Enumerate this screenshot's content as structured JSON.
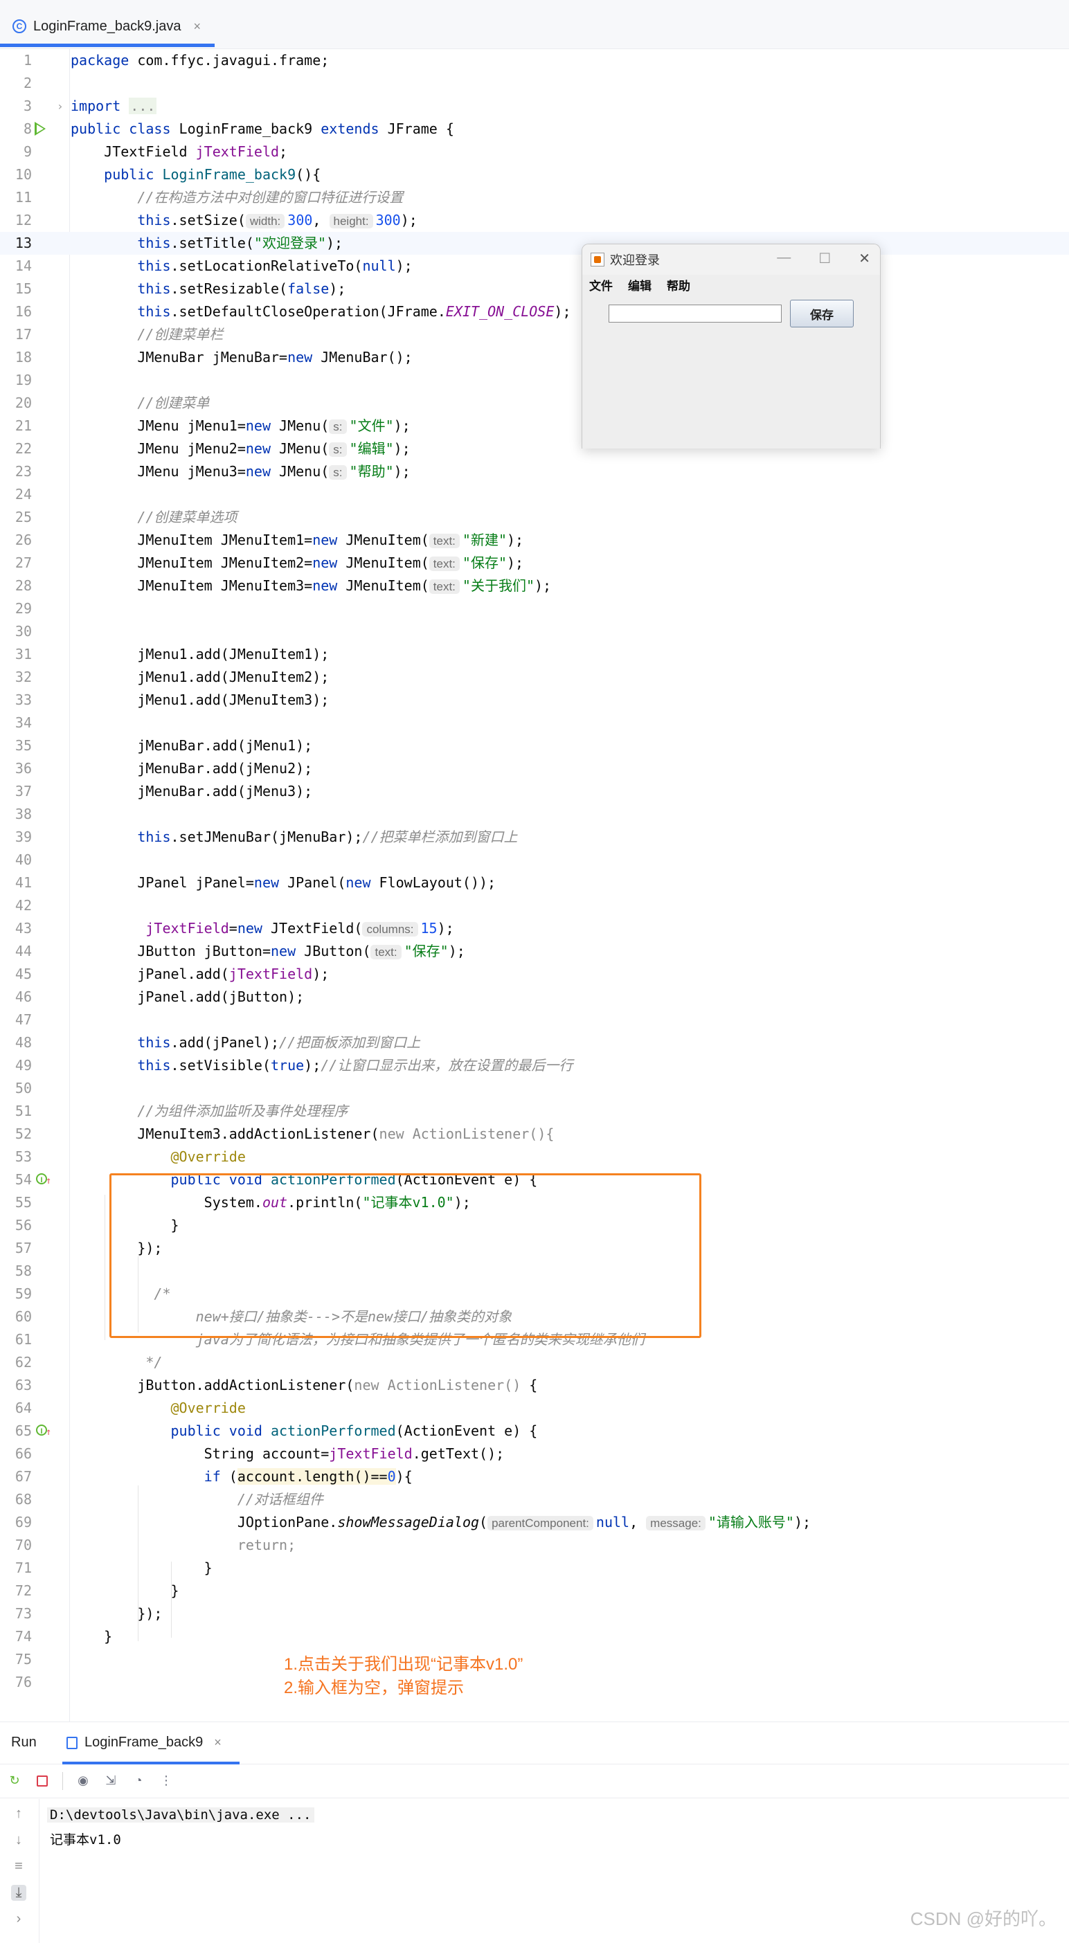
{
  "tab": {
    "filename": "LoginFrame_back9.java",
    "close": "×"
  },
  "code": {
    "l1": {
      "num": "1",
      "kw": "package",
      "rest": " com.ffyc.javagui.frame;"
    },
    "l2": {
      "num": "2"
    },
    "l3": {
      "num": "3",
      "kw": "import",
      "folded": "..."
    },
    "l4": {
      "num": "8",
      "kw1": "public",
      "kw2": "class",
      "name": " LoginFrame_back9 ",
      "kw3": "extends",
      "rest": " JFrame {"
    },
    "l5": {
      "num": "9",
      "type": "JTextField ",
      "field": "jTextField",
      "rest": ";"
    },
    "l6": {
      "num": "10",
      "kw": "public",
      "ctor": "LoginFrame_back9",
      "rest": "(){"
    },
    "l7": {
      "num": "11",
      "comment": "//在构造方法中对创建的窗口特征进行设置"
    },
    "l8": {
      "num": "12",
      "this": "this",
      "call": ".setSize(",
      "h1": "width:",
      "v1": "300",
      "sep": ", ",
      "h2": "height:",
      "v2": "300",
      "end": ");"
    },
    "l9": {
      "num": "13",
      "this": "this",
      "call": ".setTitle(",
      "str": "\"欢迎登录\"",
      "end": ");"
    },
    "l10": {
      "num": "14",
      "this": "this",
      "call": ".setLocationRelativeTo(",
      "kw": "null",
      "end": ");"
    },
    "l11": {
      "num": "15",
      "this": "this",
      "call": ".setResizable(",
      "kw": "false",
      "end": ");"
    },
    "l12": {
      "num": "16",
      "this": "this",
      "call": ".setDefaultCloseOperation(JFrame.",
      "sfield": "EXIT_ON_CLOSE",
      "end": ");"
    },
    "l13": {
      "num": "17",
      "comment": "//创建菜单栏"
    },
    "l14": {
      "num": "18",
      "a": "JMenuBar jMenuBar=",
      "kw": "new",
      "b": " JMenuBar();"
    },
    "l15": {
      "num": "19"
    },
    "l16": {
      "num": "20",
      "comment": "//创建菜单"
    },
    "l17": {
      "num": "21",
      "a": "JMenu jMenu1=",
      "kw": "new",
      "b": " JMenu(",
      "hint": "s:",
      "str": "\"文件\"",
      "end": ");"
    },
    "l18": {
      "num": "22",
      "a": "JMenu jMenu2=",
      "kw": "new",
      "b": " JMenu(",
      "hint": "s:",
      "str": "\"编辑\"",
      "end": ");"
    },
    "l19": {
      "num": "23",
      "a": "JMenu jMenu3=",
      "kw": "new",
      "b": " JMenu(",
      "hint": "s:",
      "str": "\"帮助\"",
      "end": ");"
    },
    "l20": {
      "num": "24"
    },
    "l21": {
      "num": "25",
      "comment": "//创建菜单选项"
    },
    "l22": {
      "num": "26",
      "a": "JMenuItem JMenuItem1=",
      "kw": "new",
      "b": " JMenuItem(",
      "hint": "text:",
      "str": "\"新建\"",
      "end": ");"
    },
    "l23": {
      "num": "27",
      "a": "JMenuItem JMenuItem2=",
      "kw": "new",
      "b": " JMenuItem(",
      "hint": "text:",
      "str": "\"保存\"",
      "end": ");"
    },
    "l24": {
      "num": "28",
      "a": "JMenuItem JMenuItem3=",
      "kw": "new",
      "b": " JMenuItem(",
      "hint": "text:",
      "str": "\"关于我们\"",
      "end": ");"
    },
    "l25": {
      "num": "29"
    },
    "l26": {
      "num": "30"
    },
    "l27": {
      "num": "31",
      "text": "jMenu1.add(JMenuItem1);"
    },
    "l28": {
      "num": "32",
      "text": "jMenu1.add(JMenuItem2);"
    },
    "l29": {
      "num": "33",
      "text": "jMenu1.add(JMenuItem3);"
    },
    "l30": {
      "num": "34"
    },
    "l31": {
      "num": "35",
      "text": "jMenuBar.add(jMenu1);"
    },
    "l32": {
      "num": "36",
      "text": "jMenuBar.add(jMenu2);"
    },
    "l33": {
      "num": "37",
      "text": "jMenuBar.add(jMenu3);"
    },
    "l34": {
      "num": "38"
    },
    "l35": {
      "num": "39",
      "this": "this",
      "call": ".setJMenuBar(jMenuBar);",
      "comment": "//把菜单栏添加到窗口上"
    },
    "l36": {
      "num": "40"
    },
    "l37": {
      "num": "41",
      "a": "JPanel jPanel=",
      "kw1": "new",
      "b": " JPanel(",
      "kw2": "new",
      "c": " FlowLayout());"
    },
    "l38": {
      "num": "42"
    },
    "l39": {
      "num": "43",
      "field": "jTextField",
      "a": "=",
      "kw": "new",
      "b": " JTextField(",
      "hint": "columns:",
      "n": "15",
      "end": ");"
    },
    "l40": {
      "num": "44",
      "a": "JButton jButton=",
      "kw": "new",
      "b": " JButton(",
      "hint": "text:",
      "str": "\"保存\"",
      "end": ");"
    },
    "l41": {
      "num": "45",
      "a": "jPanel.add(",
      "field": "jTextField",
      "end": ");"
    },
    "l42": {
      "num": "46",
      "text": "jPanel.add(jButton);"
    },
    "l43": {
      "num": "47"
    },
    "l44": {
      "num": "48",
      "this": "this",
      "call": ".add(jPanel);",
      "comment": "//把面板添加到窗口上"
    },
    "l45": {
      "num": "49",
      "this": "this",
      "call": ".setVisible(",
      "kw": "true",
      "end": ");",
      "comment": "//让窗口显示出来，放在设置的最后一行"
    },
    "l46": {
      "num": "50"
    },
    "l47": {
      "num": "51",
      "comment": "//为组件添加监听及事件处理程序"
    },
    "l48": {
      "num": "52",
      "a": "JMenuItem3.addActionListener(",
      "kw": "new",
      "anon": " ActionListener(){"
    },
    "l49": {
      "num": "53",
      "ann": "@Override"
    },
    "l50": {
      "num": "54",
      "kw1": "public",
      "kw2": "void",
      "fn": "actionPerformed",
      "rest": "(ActionEvent e) {"
    },
    "l51": {
      "num": "55",
      "a": "System.",
      "sfield": "out",
      "b": ".println(",
      "str": "\"记事本v1.0\"",
      "end": ");"
    },
    "l52": {
      "num": "56",
      "text": "}"
    },
    "l53": {
      "num": "57",
      "text": "});"
    },
    "l54": {
      "num": "58"
    },
    "l55": {
      "num": "59",
      "comment": "/*"
    },
    "l56": {
      "num": "60",
      "comment": "new+接口/抽象类--->不是new接口/抽象类的对象"
    },
    "l57": {
      "num": "61",
      "comment": "java为了简化语法，为接口和抽象类提供了一个匿名的类来实现继承他们"
    },
    "l58": {
      "num": "62",
      "comment": "*/"
    },
    "l59": {
      "num": "63",
      "a": "jButton.addActionListener(",
      "kw": "new",
      "anon": " ActionListener()",
      "b": " {"
    },
    "l60": {
      "num": "64",
      "ann": "@Override"
    },
    "l61": {
      "num": "65",
      "kw1": "public",
      "kw2": "void",
      "fn": "actionPerformed",
      "rest": "(ActionEvent e) {"
    },
    "l62": {
      "num": "66",
      "a": "String account=",
      "field": "jTextField",
      "b": ".getText();"
    },
    "l63": {
      "num": "67",
      "kw": "if",
      "a": " (",
      "cond": "account.length()==",
      "n": "0",
      "b": "){"
    },
    "l64": {
      "num": "68",
      "comment": "//对话框组件"
    },
    "l65": {
      "num": "69",
      "a": "JOptionPane.",
      "sm": "showMessageDialog",
      "b": "(",
      "h1": "parentComponent:",
      "kw": "null",
      "sep": ", ",
      "h2": "message:",
      "str": "\"请输入账号\"",
      "end": ");"
    },
    "l66": {
      "num": "70",
      "kw": "return",
      "end": ";"
    },
    "l67": {
      "num": "71",
      "text": "}"
    },
    "l68": {
      "num": "72",
      "text": "}"
    },
    "l69": {
      "num": "73",
      "text": "});"
    },
    "l70": {
      "num": "74",
      "text": "}"
    },
    "l71": {
      "num": "75"
    },
    "l72": {
      "num": "76"
    }
  },
  "swing_window": {
    "title": "欢迎登录",
    "menus": [
      "文件",
      "编辑",
      "帮助"
    ],
    "button": "保存",
    "controls": {
      "minimize": "—",
      "maximize": "☐",
      "close": "✕"
    }
  },
  "notes": {
    "line1": "1.点击关于我们出现“记事本v1.0”",
    "line2": "2.输入框为空，弹窗提示"
  },
  "run_panel": {
    "label": "Run",
    "tab": "LoginFrame_back9",
    "close": "×",
    "console": {
      "cmd": "D:\\devtools\\Java\\bin\\java.exe ...",
      "output": "记事本v1.0"
    }
  },
  "watermark": "CSDN @好的吖。"
}
